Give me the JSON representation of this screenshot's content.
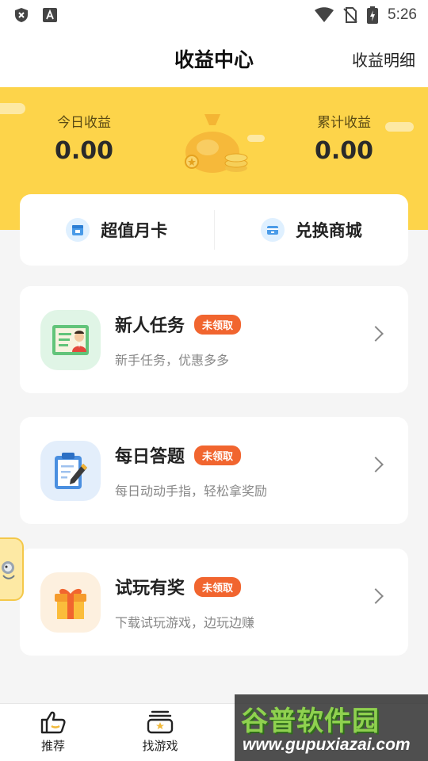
{
  "status_bar": {
    "time": "5:26",
    "icons": [
      "shield-x-icon",
      "accessibility-a-icon",
      "wifi-icon",
      "no-sim-icon",
      "battery-charging-icon"
    ]
  },
  "header": {
    "title": "收益中心",
    "details_link": "收益明细"
  },
  "earnings": {
    "today_label": "今日收益",
    "today_value": "0.00",
    "total_label": "累计收益",
    "total_value": "0.00"
  },
  "shortcuts": [
    {
      "label": "超值月卡",
      "icon": "calendar-icon"
    },
    {
      "label": "兑换商城",
      "icon": "store-icon"
    }
  ],
  "tasks": [
    {
      "title": "新人任务",
      "badge": "未领取",
      "desc": "新手任务，优惠多多",
      "icon": "id-card-icon"
    },
    {
      "title": "每日答题",
      "badge": "未领取",
      "desc": "每日动动手指，轻松拿奖励",
      "icon": "clipboard-pen-icon"
    },
    {
      "title": "试玩有奖",
      "badge": "未领取",
      "desc": "下载试玩游戏，边玩边赚",
      "icon": "gift-box-icon"
    }
  ],
  "bottom_nav": [
    {
      "label": "推荐",
      "icon": "thumbs-up-icon"
    },
    {
      "label": "找游戏",
      "icon": "game-box-icon"
    }
  ],
  "watermark": {
    "brand": "谷普软件园",
    "url": "www.gupuxiazai.com"
  },
  "colors": {
    "banner_yellow": "#fdd44a",
    "badge_orange": "#f1652f",
    "watermark_green": "#8fd14f"
  }
}
